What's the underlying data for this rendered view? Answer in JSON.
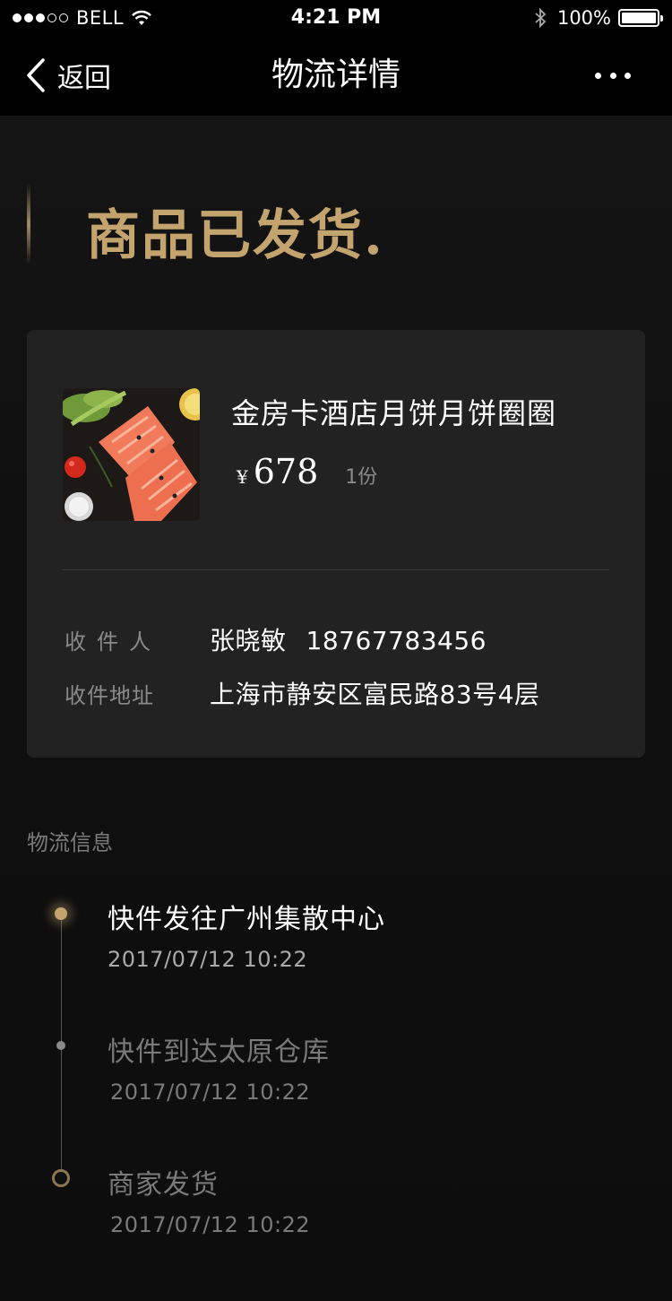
{
  "status_bar": {
    "carrier": "BELL",
    "time": "4:21 PM",
    "battery": "100%",
    "signal_bars": 3,
    "signal_total": 5,
    "battery_level": 1.0
  },
  "nav": {
    "back_label": "返回",
    "title": "物流详情"
  },
  "headline": "商品已发货.",
  "order": {
    "product_name": "金房卡酒店月饼月饼圈圈",
    "price_symbol": "¥",
    "price": "678",
    "quantity": "1份",
    "recipient_label": "收件人",
    "recipient_name": "张晓敏",
    "recipient_phone": "18767783456",
    "address_label": "收件地址",
    "address": "上海市静安区富民路83号4层"
  },
  "logistics": {
    "section_title": "物流信息",
    "events": [
      {
        "event": "快件发往广州集散中心",
        "time": "2017/07/12 10:22"
      },
      {
        "event": "快件到达太原仓库",
        "time": "2017/07/12 10:22"
      },
      {
        "event": "商家发货",
        "time": "2017/07/12 10:22"
      }
    ]
  },
  "colors": {
    "accent_gold": "#c4a46e",
    "card_bg": "#222222",
    "page_bg": "#121212",
    "muted_text": "#8a8a8a"
  }
}
